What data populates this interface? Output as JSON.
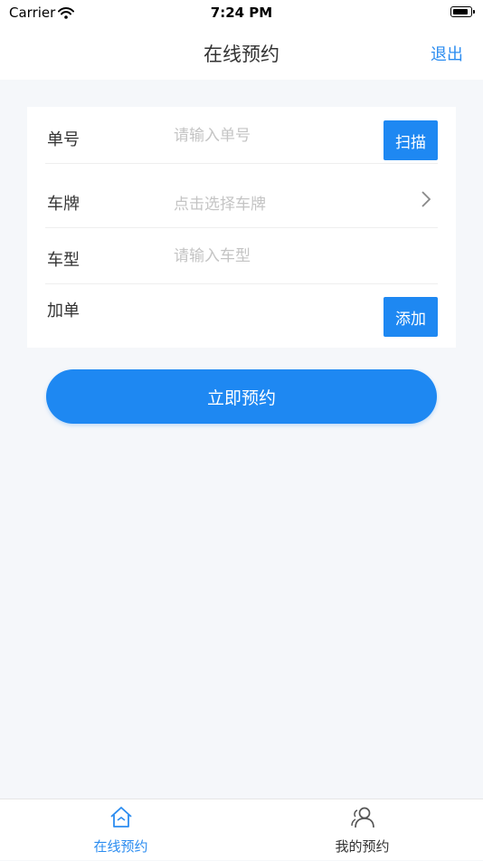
{
  "status_bar": {
    "carrier": "Carrier",
    "time": "7:24 PM"
  },
  "nav": {
    "title": "在线预约",
    "logout_label": "退出"
  },
  "form": {
    "order_no": {
      "label": "单号",
      "placeholder": "请输入单号",
      "button": "扫描"
    },
    "plate": {
      "label": "车牌",
      "placeholder": "点击选择车牌"
    },
    "vehicle_type": {
      "label": "车型",
      "placeholder": "请输入车型"
    },
    "add_order": {
      "label": "加单",
      "button": "添加"
    }
  },
  "submit_label": "立即预约",
  "tabs": [
    {
      "label": "在线预约",
      "icon": "home-icon",
      "active": true
    },
    {
      "label": "我的预约",
      "icon": "user-icon",
      "active": false
    }
  ],
  "colors": {
    "accent": "#1e88f2",
    "link": "#2b8cf0",
    "background": "#f5f7fa"
  }
}
